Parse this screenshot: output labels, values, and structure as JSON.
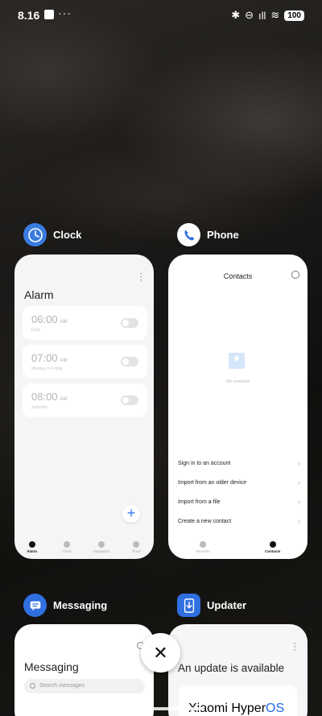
{
  "status_bar": {
    "time": "8.16",
    "dots": "···",
    "bluetooth": "✱",
    "dnd": "⊖",
    "signal": "ıll",
    "wifi": "≋",
    "battery": "100"
  },
  "apps": {
    "clock": {
      "label": "Clock",
      "icon": "clock-icon",
      "color": "#3a7be0",
      "screen_title": "Alarm",
      "alarms": [
        {
          "time": "06:00",
          "ampm": "AM",
          "sub": "Daily"
        },
        {
          "time": "07:00",
          "ampm": "AM",
          "sub": "Monday to Friday"
        },
        {
          "time": "08:00",
          "ampm": "AM",
          "sub": "Saturday"
        }
      ],
      "fab": "+",
      "nav": [
        "Alarm",
        "Clock",
        "Stopwatch",
        "Timer"
      ]
    },
    "phone": {
      "label": "Phone",
      "icon": "phone-icon",
      "color": "#2f6fe0",
      "screen_title": "Contacts",
      "empty_text": "No contacts",
      "options": [
        "Sign in to an account",
        "Import from an older device",
        "Import from a file",
        "Create a new contact"
      ],
      "nav": [
        "Recents",
        "Contacts"
      ]
    },
    "messaging": {
      "label": "Messaging",
      "icon": "message-icon",
      "color": "#2f6fe0",
      "screen_title": "Messaging",
      "search_placeholder": "Search messages"
    },
    "updater": {
      "label": "Updater",
      "icon": "download-icon",
      "color": "#2f6fe0",
      "screen_title": "An update is available",
      "brand_main": "Xiaomi Hyper",
      "brand_os": "OS"
    }
  },
  "close_button": "✕"
}
